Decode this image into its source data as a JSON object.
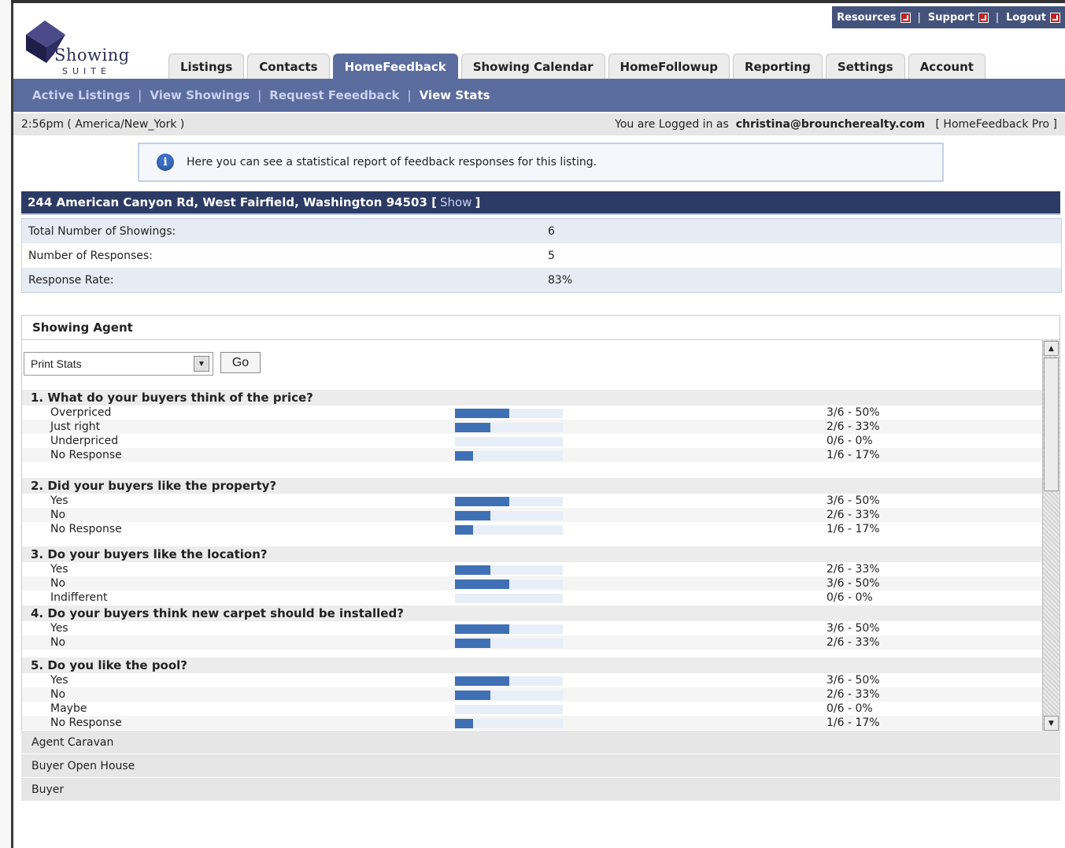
{
  "header": {
    "top_links": [
      {
        "label": "Resources"
      },
      {
        "label": "Support"
      },
      {
        "label": "Logout"
      }
    ],
    "separator": "|",
    "logo": {
      "word": "Showing",
      "sub": "SUITE"
    },
    "tabs": [
      {
        "label": "Listings"
      },
      {
        "label": "Contacts"
      },
      {
        "label": "HomeFeedback"
      },
      {
        "label": "Showing Calendar"
      },
      {
        "label": "HomeFollowup"
      },
      {
        "label": "Reporting"
      },
      {
        "label": "Settings"
      },
      {
        "label": "Account"
      }
    ],
    "active_tab": "HomeFeedback",
    "subnav": [
      {
        "label": "Active Listings"
      },
      {
        "label": "View Showings"
      },
      {
        "label": "Request Feeedback"
      },
      {
        "label": "View Stats"
      }
    ],
    "subnav_separator": "|"
  },
  "status": {
    "time": "2:56pm ( America/New_York )",
    "logged_prefix": "You are Logged in as",
    "user": "christina@brouncherealty.com",
    "plan": "[ HomeFeedback Pro ]"
  },
  "info": {
    "icon_letter": "i",
    "text": "Here you can see a statistical report of feedback responses for this listing."
  },
  "listing": {
    "address": "244 American Canyon Rd, West Fairfield, Washington 94503 [",
    "show_label": "Show",
    "close_bracket": "]"
  },
  "summary": [
    {
      "label": "Total Number of Showings:",
      "value": "6"
    },
    {
      "label": "Number of Responses:",
      "value": "5"
    },
    {
      "label": "Response Rate:",
      "value": "83%"
    }
  ],
  "panel": {
    "title": "Showing Agent",
    "select_value": "Print Stats",
    "go_label": "Go"
  },
  "questions": [
    {
      "title": "1.  What do your buyers think of the price?",
      "answers": [
        {
          "label": "Overpriced",
          "value": "3/6 - 50%",
          "fraction": 0.5
        },
        {
          "label": "Just right",
          "value": "2/6 - 33%",
          "fraction": 0.33
        },
        {
          "label": "Underpriced",
          "value": "0/6 - 0%",
          "fraction": 0
        },
        {
          "label": "No Response",
          "value": "1/6 - 17%",
          "fraction": 0.17
        }
      ]
    },
    {
      "title": "2.  Did your buyers like the property?",
      "answers": [
        {
          "label": "Yes",
          "value": "3/6 - 50%",
          "fraction": 0.5
        },
        {
          "label": "No",
          "value": "2/6 - 33%",
          "fraction": 0.33
        },
        {
          "label": "No Response",
          "value": "1/6 - 17%",
          "fraction": 0.17
        }
      ]
    },
    {
      "title": "3.  Do your buyers like the location?",
      "answers": [
        {
          "label": "Yes",
          "value": "2/6 - 33%",
          "fraction": 0.33
        },
        {
          "label": "No",
          "value": "3/6 - 50%",
          "fraction": 0.5
        },
        {
          "label": "Indifferent",
          "value": "0/6 - 0%",
          "fraction": 0
        }
      ]
    },
    {
      "title": "4.  Do your buyers think new carpet should be installed?",
      "answers": [
        {
          "label": "Yes",
          "value": "3/6 - 50%",
          "fraction": 0.5
        },
        {
          "label": "No",
          "value": "2/6 - 33%",
          "fraction": 0.33
        }
      ]
    },
    {
      "title": "5.  Do you like the pool?",
      "answers": [
        {
          "label": "Yes",
          "value": "3/6 - 50%",
          "fraction": 0.5
        },
        {
          "label": "No",
          "value": "2/6 - 33%",
          "fraction": 0.33
        },
        {
          "label": "Maybe",
          "value": "0/6 - 0%",
          "fraction": 0
        },
        {
          "label": "No Response",
          "value": "1/6 - 17%",
          "fraction": 0.17
        }
      ]
    }
  ],
  "sections": [
    {
      "label": "Agent Caravan"
    },
    {
      "label": "Buyer Open House"
    },
    {
      "label": "Buyer"
    }
  ],
  "colors": {
    "header_blue": "#5b6c9e",
    "address_bar": "#2c3b66",
    "bar_fill": "#3f70b5",
    "bar_track": "#e8eef7"
  }
}
